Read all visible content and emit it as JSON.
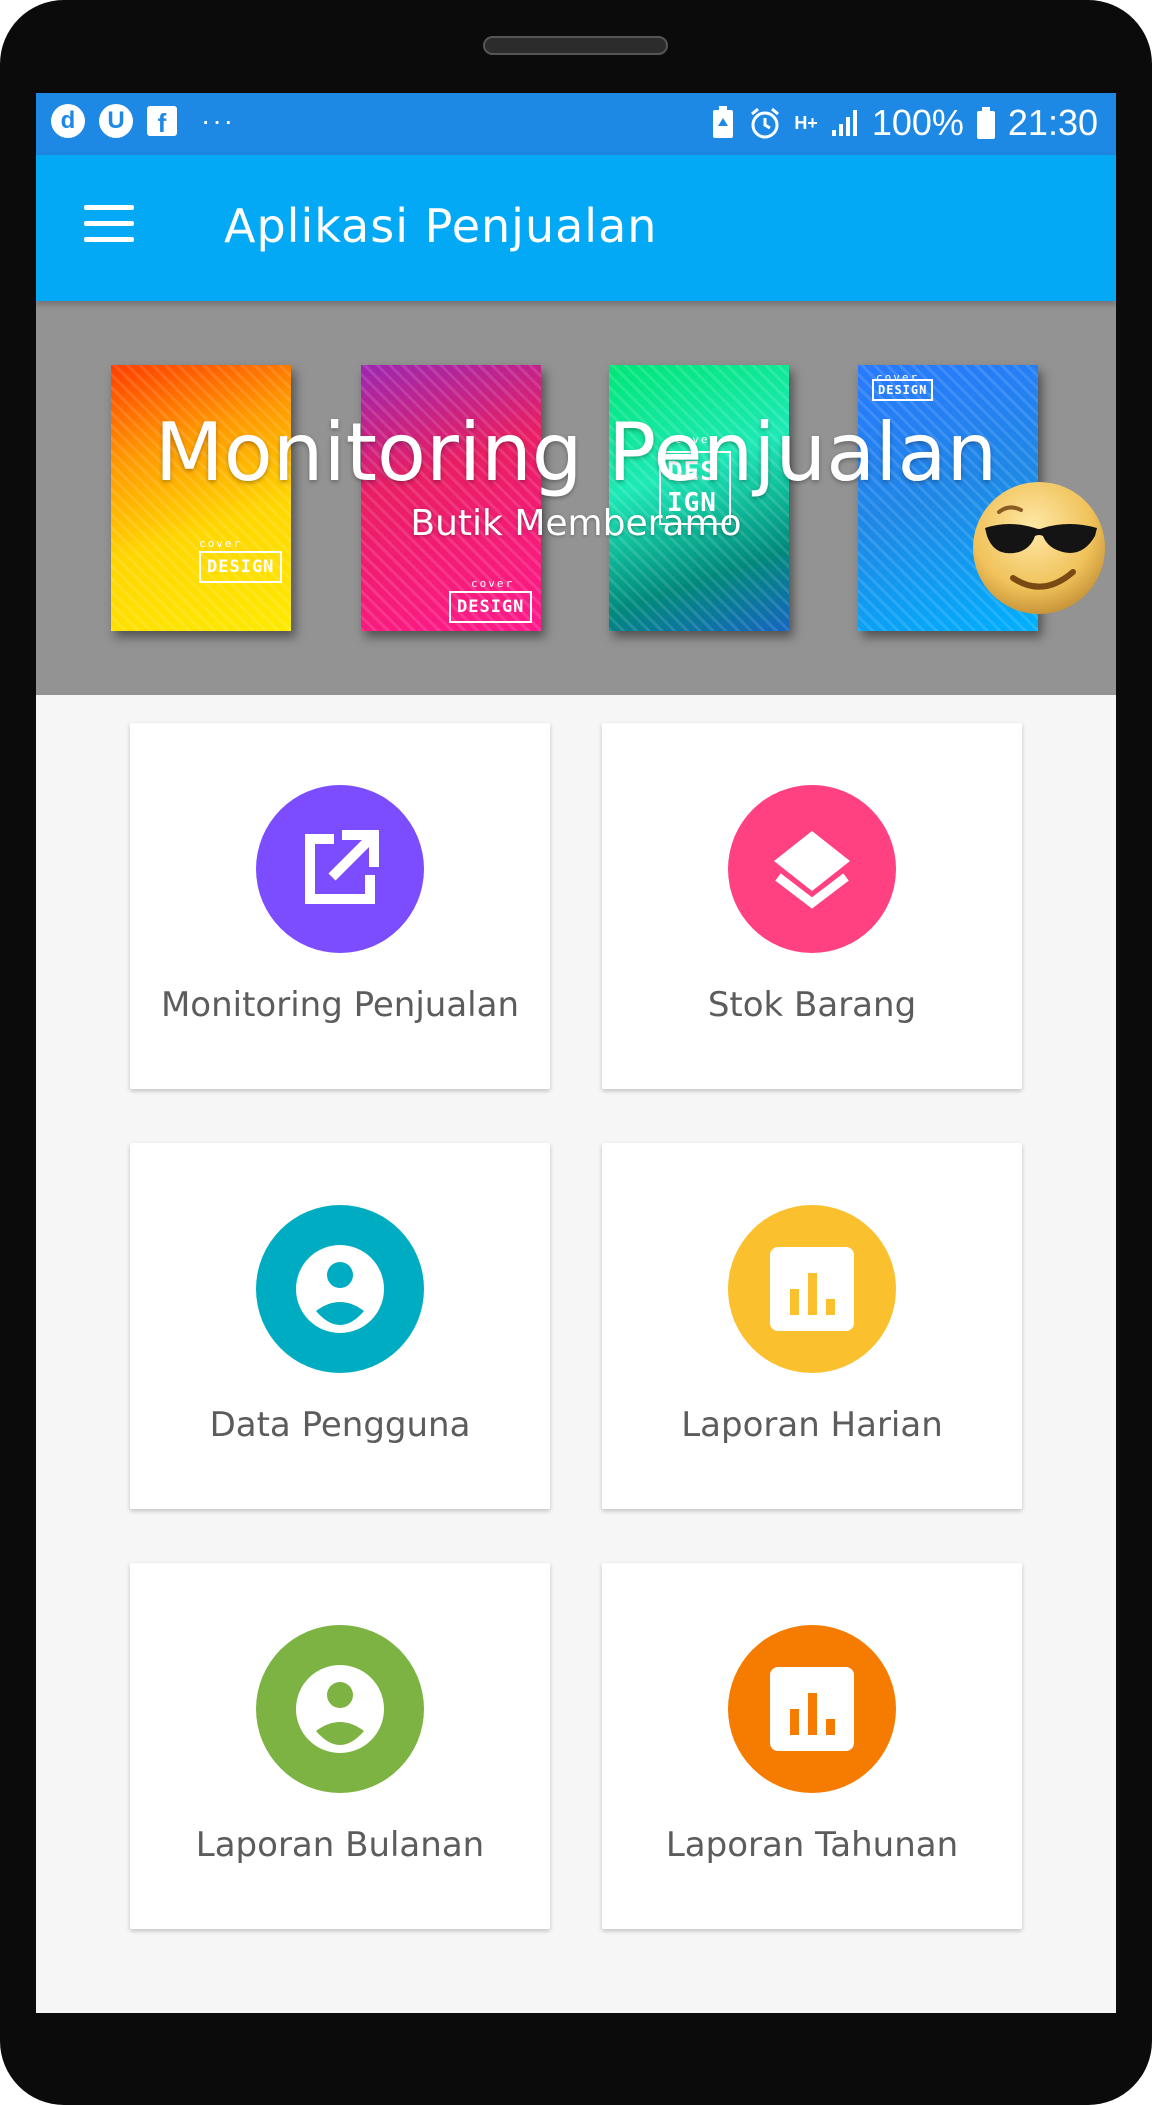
{
  "status_bar": {
    "notif_icons": [
      "d",
      "U",
      "f"
    ],
    "overflow": "···",
    "network": "H+",
    "battery": "100%",
    "time": "21:30"
  },
  "app_bar": {
    "title": "Aplikasi Penjualan"
  },
  "banner": {
    "title": "Monitoring Penjualan",
    "subtitle": "Butik Memberamo",
    "covers": [
      {
        "tag": "DESIGN",
        "small": "cover"
      },
      {
        "tag": "DESIGN",
        "small": "cover"
      },
      {
        "tag": "DESIGN",
        "small": "cover"
      },
      {
        "tag": "DESIGN",
        "small": "cover"
      }
    ]
  },
  "menu": [
    {
      "label": "Monitoring Penjualan",
      "icon": "open-in-new-icon",
      "color": "#7c4dff"
    },
    {
      "label": "Stok Barang",
      "icon": "layers-icon",
      "color": "#ff4081"
    },
    {
      "label": "Data Pengguna",
      "icon": "account-circle-icon",
      "color": "#00acc1"
    },
    {
      "label": "Laporan Harian",
      "icon": "chart-icon",
      "color": "#fbc02d"
    },
    {
      "label": "Laporan Bulanan",
      "icon": "account-circle-icon",
      "color": "#7cb342"
    },
    {
      "label": "Laporan Tahunan",
      "icon": "chart-icon",
      "color": "#f57c00"
    }
  ],
  "colors": {
    "status_bar": "#1e88e5",
    "app_bar": "#03a9f4",
    "banner_bg": "#939393"
  }
}
